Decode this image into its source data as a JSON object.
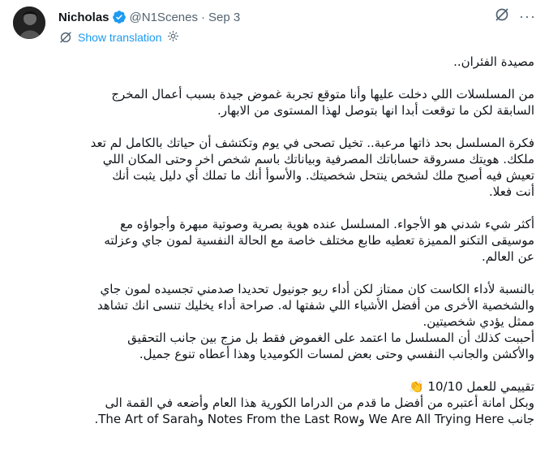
{
  "user": {
    "name": "Nicholas",
    "handle": "@N1Scenes",
    "separator": "·",
    "date": "Sep 3",
    "verified_color": "#1d9bf0"
  },
  "actions": {
    "more_label": "···"
  },
  "translation": {
    "label": "Show translation"
  },
  "tweet": {
    "title": "مصيدة الفئران..",
    "p1_l1": "من المسلسلات اللي دخلت عليها وأنا متوقع تجربة غموض جيدة بسبب أعمال المخرج",
    "p1_l2": "السابقة لكن ما توقعت أبدا انها بتوصل لهذا المستوى من الابهار.",
    "p2_l1": "فكرة المسلسل بحد ذاتها مرعبة.. تخيل تصحى في يوم وتكتشف أن حياتك بالكامل لم تعد",
    "p2_l2": "ملكك. هويتك مسروقة حساباتك المصرفية وبياناتك باسم شخص اخر وحتى المكان اللي",
    "p2_l3": "تعيش فيه أصبح ملك لشخص ينتحل شخصيتك. والأسوأ أنك ما تملك أي دليل يثبت أنك",
    "p2_l4": "أنت فعلا.",
    "p3_l1": "أكثر شيء شدني هو الأجواء. المسلسل عنده هوية بصرية وصوتية مبهرة وأجواؤه مع",
    "p3_l2": "موسيقى التكنو المميزة تعطيه طابع مختلف خاصة مع الحالة النفسية لمون جاي وعزلته",
    "p3_l3": "عن العالم.",
    "p4_l1": "بالنسبة لأداء الكاست كان ممتاز  لكن أداء ريو جونيول تحديدا صدمني تجسيده لمون جاي",
    "p4_l2": "والشخصية الأخرى من أفضل الأشياء اللي شفتها له. صراحة أداء يخليك تنسى انك تشاهد",
    "p4_l3": "ممثل يؤدي شخصيتين.",
    "p5_l1": "أحببت كذلك أن المسلسل ما اعتمد على الغموض فقط بل مزج بين جانب التحقيق",
    "p5_l2": "والأكشن والجانب النفسي وحتى بعض لمسات الكوميديا وهذا أعطاه تنوع جميل.",
    "rating": "تقييمي للعمل 10/10",
    "rating_emoji": "👏",
    "p6_l1": "وبكل امانة أعتبره من أفضل ما قدم من الدراما الكورية هذا العام وأضعه في القمة الى",
    "p6_l2a": "جانب",
    "p6_t1": "We Are All Trying Here",
    "p6_and1": "و",
    "p6_t2": "Notes From the Last Row",
    "p6_and2": "و",
    "p6_t3": "The Art of Sarah",
    "p6_end": "."
  }
}
